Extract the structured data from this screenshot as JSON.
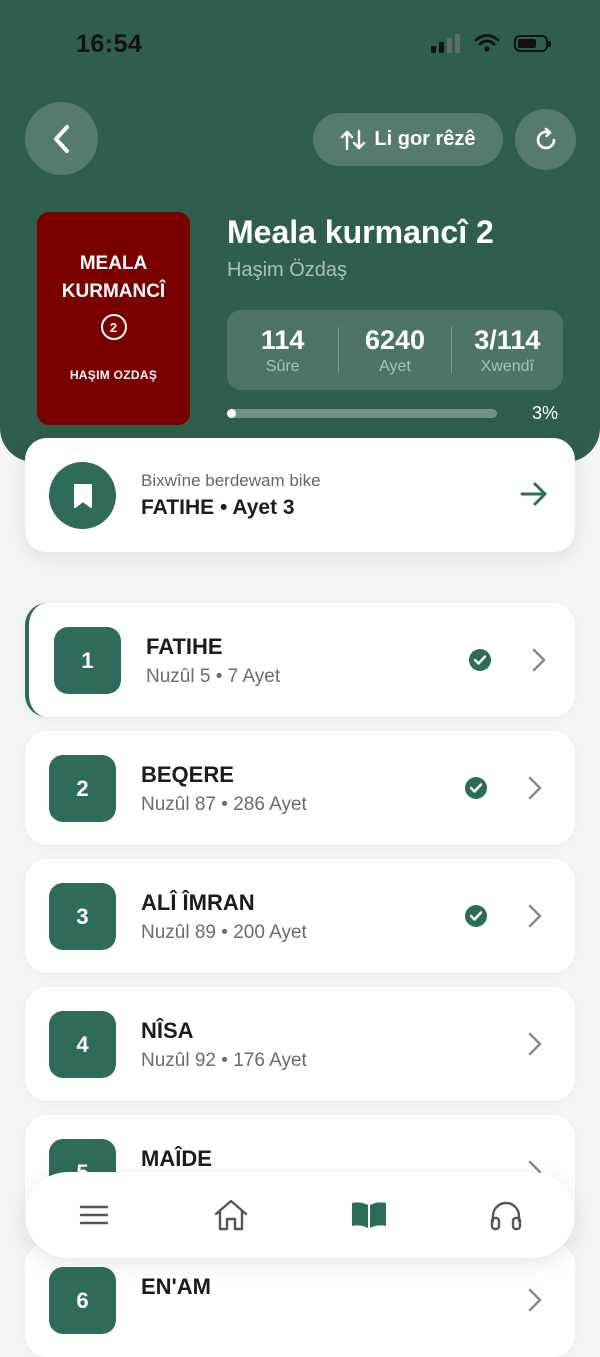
{
  "status": {
    "time": "16:54"
  },
  "header": {
    "sort_label": "Li gor rêzê",
    "cover": {
      "title_line1": "MEALA",
      "title_line2": "KURMANCÎ",
      "number": "2",
      "author": "HAŞIM OZDAŞ"
    },
    "title": "Meala kurmancî 2",
    "author": "Haşim Özdaş",
    "stats": [
      {
        "value": "114",
        "label": "Sûre"
      },
      {
        "value": "6240",
        "label": "Ayet"
      },
      {
        "value": "3/114",
        "label": "Xwendî"
      }
    ],
    "progress_fraction": 0.03,
    "progress_text": "3%"
  },
  "continue": {
    "label": "Bixwîne berdewam bike",
    "value": "FATIHE • Ayet 3"
  },
  "surahs": [
    {
      "num": "1",
      "name": "FATIHE",
      "meta": "Nuzûl 5 • 7 Ayet",
      "read": true,
      "active": true
    },
    {
      "num": "2",
      "name": "BEQERE",
      "meta": "Nuzûl 87 • 286 Ayet",
      "read": true
    },
    {
      "num": "3",
      "name": "ALÎ ÎMRAN",
      "meta": "Nuzûl 89 • 200 Ayet",
      "read": true
    },
    {
      "num": "4",
      "name": "NÎSA",
      "meta": "Nuzûl 92 • 176 Ayet",
      "read": false
    },
    {
      "num": "5",
      "name": "MAÎDE",
      "meta": "",
      "read": false
    },
    {
      "num": "6",
      "name": "EN'AM",
      "meta": "",
      "read": false
    }
  ],
  "nav": [
    {
      "icon": "menu-icon"
    },
    {
      "icon": "home-icon"
    },
    {
      "icon": "book-icon",
      "active": true
    },
    {
      "icon": "headphones-icon"
    }
  ],
  "colors": {
    "primary": "#2f5f4c",
    "accent": "#2f6b5c",
    "cover": "#7a0000"
  }
}
